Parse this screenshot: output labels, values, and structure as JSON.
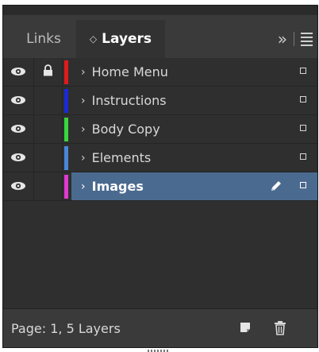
{
  "tabs": {
    "links": "Links",
    "layers": "Layers",
    "layers_chevron": "◇",
    "overflow": "»"
  },
  "layers": [
    {
      "name": "Home Menu",
      "color": "#e01b1b",
      "visible": true,
      "locked": true,
      "selected": false
    },
    {
      "name": "Instructions",
      "color": "#1a2ad6",
      "visible": true,
      "locked": false,
      "selected": false
    },
    {
      "name": "Body Copy",
      "color": "#39d63c",
      "visible": true,
      "locked": false,
      "selected": false
    },
    {
      "name": "Elements",
      "color": "#4a86d8",
      "visible": true,
      "locked": false,
      "selected": false
    },
    {
      "name": "Images",
      "color": "#e03ad0",
      "visible": true,
      "locked": false,
      "selected": true
    }
  ],
  "row_arrow": "›",
  "footer": {
    "status": "Page: 1, 5 Layers"
  },
  "icons": {
    "eye": "eye-icon",
    "lock": "lock-icon",
    "pen": "pen-icon",
    "new_layer": "new-layer-icon",
    "trash": "trash-icon",
    "menu": "panel-menu-icon"
  }
}
